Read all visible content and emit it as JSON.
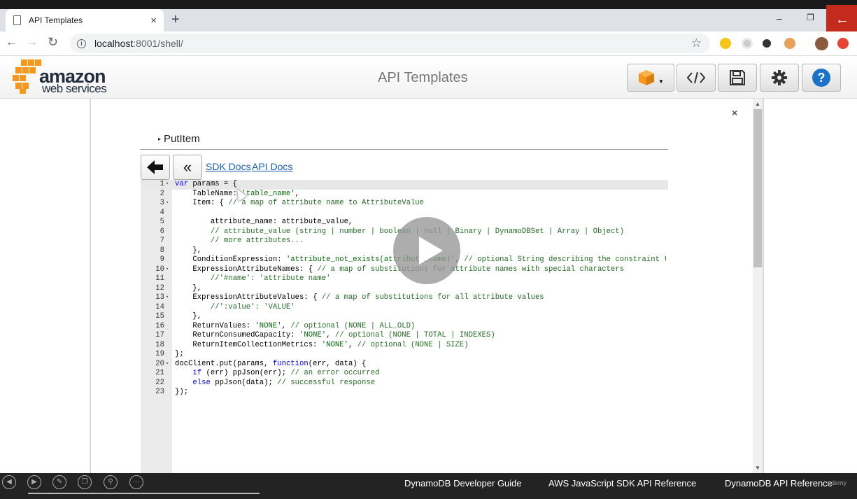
{
  "browser": {
    "tab_title": "API Templates",
    "tab_close": "×",
    "new_tab": "+",
    "url_host": "localhost",
    "url_rest": ":8001/shell/",
    "win_minimize": "–",
    "win_restore": "❐",
    "win_close_arrow": "←"
  },
  "header": {
    "logo_top": "amazon",
    "logo_bottom": "web services",
    "title": "API Templates"
  },
  "dialog": {
    "close": "×",
    "operation": "PutItem",
    "links": [
      "SDK Docs",
      "API Docs"
    ]
  },
  "code_lines": [
    {
      "n": "1",
      "fold": "▾"
    },
    {
      "n": "2",
      "fold": ""
    },
    {
      "n": "3",
      "fold": "▾"
    },
    {
      "n": "4",
      "fold": ""
    },
    {
      "n": "5",
      "fold": ""
    },
    {
      "n": "6",
      "fold": ""
    },
    {
      "n": "7",
      "fold": ""
    },
    {
      "n": "8",
      "fold": ""
    },
    {
      "n": "9",
      "fold": ""
    },
    {
      "n": "10",
      "fold": "▾"
    },
    {
      "n": "11",
      "fold": ""
    },
    {
      "n": "12",
      "fold": ""
    },
    {
      "n": "13",
      "fold": "▾"
    },
    {
      "n": "14",
      "fold": ""
    },
    {
      "n": "15",
      "fold": ""
    },
    {
      "n": "16",
      "fold": ""
    },
    {
      "n": "17",
      "fold": ""
    },
    {
      "n": "18",
      "fold": ""
    },
    {
      "n": "19",
      "fold": ""
    },
    {
      "n": "20",
      "fold": "▾"
    },
    {
      "n": "21",
      "fold": ""
    },
    {
      "n": "22",
      "fold": ""
    },
    {
      "n": "23",
      "fold": ""
    }
  ],
  "code": {
    "l1_kw": "var",
    "l1_rest": " params = {",
    "l2_a": "    TableName: ",
    "l2_str": "'table_name'",
    "l2_b": ",",
    "l3_a": "    Item: { ",
    "l3_cmt": "// a map of attribute name to AttributeValue",
    "l5": "        attribute_name: attribute_value,",
    "l6": "        // attribute_value (string | number | boolean | null | Binary | DynamoDBSet | Array | Object)",
    "l7": "        // more attributes...",
    "l8": "    },",
    "l9_a": "    ConditionExpression: ",
    "l9_str": "'attribute_not_exists(attribute_name)'",
    "l9_b": ", ",
    "l9_cmt": "// optional String describing the constraint t",
    "l10_a": "    ExpressionAttributeNames: { ",
    "l10_cmt": "// a map of substitutions for attribute names with special characters",
    "l11": "        //'#name': 'attribute name'",
    "l12": "    },",
    "l13_a": "    ExpressionAttributeValues: { ",
    "l13_cmt": "// a map of substitutions for all attribute values",
    "l14": "        //':value': 'VALUE'",
    "l15": "    },",
    "l16_a": "    ReturnValues: ",
    "l16_str": "'NONE'",
    "l16_b": ", ",
    "l16_cmt": "// optional (NONE | ALL_OLD)",
    "l17_a": "    ReturnConsumedCapacity: ",
    "l17_str": "'NONE'",
    "l17_b": ", ",
    "l17_cmt": "// optional (NONE | TOTAL | INDEXES)",
    "l18_a": "    ReturnItemCollectionMetrics: ",
    "l18_str": "'NONE'",
    "l18_b": ", ",
    "l18_cmt": "// optional (NONE | SIZE)",
    "l19": "};",
    "l20_a": "docClient.put(params, ",
    "l20_kw": "function",
    "l20_b": "(err, data) {",
    "l21_kw": "    if",
    "l21_a": " (err) ppJson(err); ",
    "l21_cmt": "// an error occurred",
    "l22_kw": "    else",
    "l22_a": " ppJson(data); ",
    "l22_cmt": "// successful response",
    "l23": "});"
  },
  "bottom_links": [
    "DynamoDB Developer Guide",
    "AWS JavaScript SDK API Reference",
    "DynamoDB API Reference"
  ],
  "watermark": "udemy",
  "colors": {
    "aws_orange": "#f7981d",
    "help_blue": "#1a73c8",
    "link": "#1a5fb4"
  }
}
